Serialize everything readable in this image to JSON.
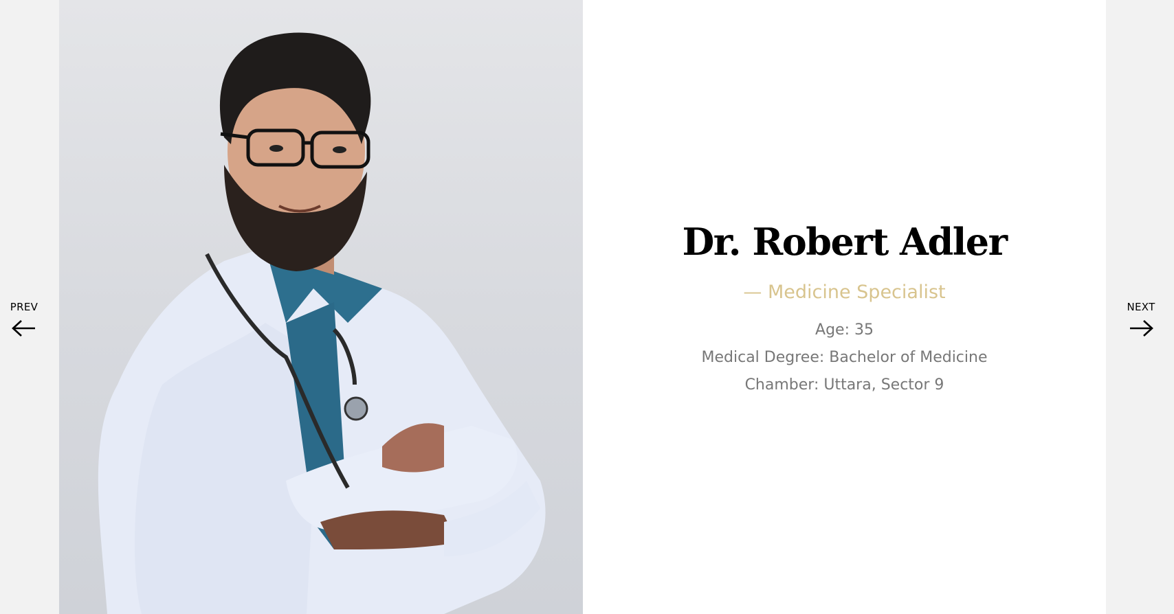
{
  "doctor": {
    "name": "Dr. Robert Adler",
    "specialty": "— Medicine Specialist",
    "age": "Age: 35",
    "degree": "Medical Degree: Bachelor of Medicine",
    "chamber": "Chamber: Uttara, Sector 9",
    "photo_icon": "doctor-portrait-photo"
  },
  "nav": {
    "prev_label": "PREV",
    "next_label": "NEXT",
    "prev_icon": "arrow-left-icon",
    "next_icon": "arrow-right-icon"
  },
  "colors": {
    "accent": "#d8c48e",
    "text_muted": "#777777",
    "page_bg": "#f2f2f2",
    "card_bg": "#ffffff"
  }
}
